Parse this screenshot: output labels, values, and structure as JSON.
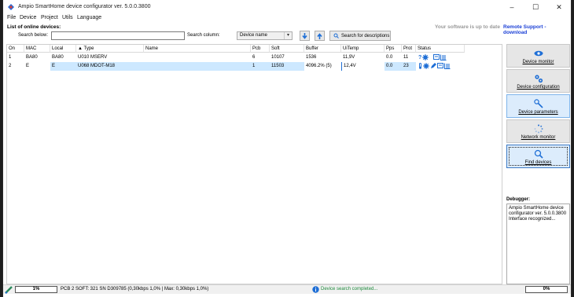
{
  "window": {
    "title": "Ampio SmartHome device configurator ver. 5.0.0.3800",
    "controls": [
      "–",
      "☐",
      "✕"
    ]
  },
  "menu": [
    "File",
    "Device",
    "Project",
    "Utils",
    "Language"
  ],
  "header": {
    "online_label": "List of online devices:",
    "update_text": "Your software is up to date",
    "support_link": "Remote Support - download"
  },
  "search": {
    "label": "Search below:",
    "value": "",
    "column_label": "Search column:",
    "column_value": "Device name",
    "descriptions_button": "Search for descriptions"
  },
  "table": {
    "columns": [
      "On",
      "MAC",
      "Local",
      "▲ Type",
      "Name",
      "Pcb",
      "Soft",
      "Buffer",
      "UiTemp",
      "Pps",
      "Prot",
      "Status"
    ],
    "rows": [
      {
        "on": "1",
        "mac": "BA80",
        "local": "BA80",
        "type": "U010 MSERV",
        "name": "",
        "pcb": "6",
        "soft": "10107",
        "buffer": "1536",
        "uitemp": "11,9V",
        "pps": "0.0",
        "prot": "11"
      },
      {
        "on": "2",
        "mac": "E",
        "local": "E",
        "type": "U068 MDOT-M18",
        "name": "",
        "pcb": "1",
        "soft": "11503",
        "buffer": "4096.2% (5)",
        "uitemp": "12,4V",
        "pps": "0.0",
        "prot": "23"
      }
    ]
  },
  "sidebar": {
    "buttons": [
      {
        "label": "Device monitor",
        "icon": "eye-icon"
      },
      {
        "label": "Device configuration",
        "icon": "gears-icon"
      },
      {
        "label": "Device parameters",
        "icon": "wrench-icon"
      },
      {
        "label": "Network monitor",
        "icon": "spinner-icon"
      },
      {
        "label": "Find devices",
        "icon": "search-icon"
      }
    ]
  },
  "debugger": {
    "label": "Debugger:",
    "text": "Ampio SmartHome device configurator ver. 5.0.0.3800 Interface recognized..."
  },
  "statusbar": {
    "progress_left": "1%",
    "info": "PCB 2 SOFT: 321 SN D309785 (0,30kbps 1,0% | Max: 0,30kbps 1,0%)",
    "message": "Device search completed...",
    "progress_right": "0%"
  },
  "colors": {
    "accent": "#1a3fd6",
    "selection": "#cde8ff",
    "button_active": "#dcecfc",
    "status_green": "#1e8a3c"
  }
}
